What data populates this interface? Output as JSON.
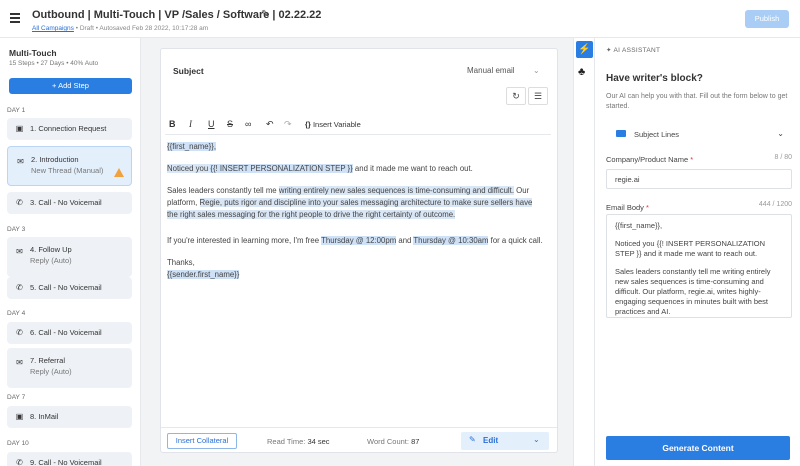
{
  "header": {
    "title": "Outbound | Multi-Touch | VP /Sales / Software | 02.22.22",
    "breadcrumb_link": "All Campaigns",
    "breadcrumb_rest": "• Draft • Autosaved Feb 28 2022, 10:17:28 am",
    "publish_label": "Publish"
  },
  "sidebar": {
    "title": "Multi-Touch",
    "meta": "15 Steps • 27 Days • 40% Auto",
    "add_step_label": "+ Add Step",
    "days": [
      "DAY 1",
      "DAY 3",
      "DAY 4",
      "DAY 7",
      "DAY 10"
    ],
    "steps": [
      {
        "label": "1. Connection Request",
        "icon": "linkedin-icon"
      },
      {
        "label": "2. Introduction",
        "sub": "New Thread (Manual)",
        "icon": "email-icon"
      },
      {
        "label": "3. Call - No Voicemail",
        "icon": "phone-icon"
      },
      {
        "label": "4. Follow Up",
        "sub": "Reply (Auto)",
        "icon": "email-icon"
      },
      {
        "label": "5. Call - No Voicemail",
        "icon": "phone-icon"
      },
      {
        "label": "6. Call - No Voicemail",
        "icon": "phone-icon"
      },
      {
        "label": "7. Referral",
        "sub": "Reply (Auto)",
        "icon": "email-icon"
      },
      {
        "label": "8. InMail",
        "icon": "linkedin-icon"
      },
      {
        "label": "9. Call - No Voicemail",
        "icon": "phone-icon"
      }
    ]
  },
  "editor": {
    "subject_label": "Subject",
    "type_value": "Manual email",
    "insert_variable_label": "Insert Variable",
    "body": {
      "greeting": "{{first_name}},",
      "p1_a": "Noticed you ",
      "p1_var": "{{! INSERT PERSONALIZATION STEP }}",
      "p1_b": " and it made me want to reach out.",
      "p2_a": "Sales leaders constantly tell me ",
      "p2_hl": "writing entirely new sales sequences is time-consuming and difficult.",
      "p2_b": " Our platform, ",
      "p2_hl2": "Regie, puts rigor and discipline into your sales messaging architecture to make sure sellers have the right sales messaging for the right people to drive the right certainty of outcome.",
      "p3_a": "If you're interested in learning more, I'm free ",
      "p3_t1": "Thursday @ 12:00pm",
      "p3_b": " and ",
      "p3_t2": "Thursday @ 10:30am",
      "p3_c": " for a quick call.",
      "signoff": "Thanks,",
      "sender": "{{sender.first_name}}"
    },
    "footer": {
      "insert_collateral_label": "Insert Collateral",
      "read_time_label": "Read Time:",
      "read_time_value": "34 sec",
      "word_count_label": "Word Count:",
      "word_count_value": "87",
      "edit_label": "Edit"
    }
  },
  "ai_panel": {
    "header": "AI ASSISTANT",
    "title": "Have writer's block?",
    "description": "Our AI can help you with that. Fill out the form below to get started.",
    "content_type": "Subject Lines",
    "company_label": "Company/Product Name",
    "company_count": "8 / 80",
    "company_value": "regie.ai",
    "email_label": "Email Body",
    "email_count": "444 / 1200",
    "email_body": [
      "{{first_name}},",
      "Noticed you {{! INSERT PERSONALIZATION STEP }} and it made me want to reach out.",
      "Sales leaders constantly tell me writing entirely new sales sequences is time-consuming and difficult. Our platform, regie.ai, writes highly-engaging sequences in minutes built with best practices and AI."
    ],
    "generate_label": "Generate Content",
    "accent_color": "#2a7de1"
  }
}
